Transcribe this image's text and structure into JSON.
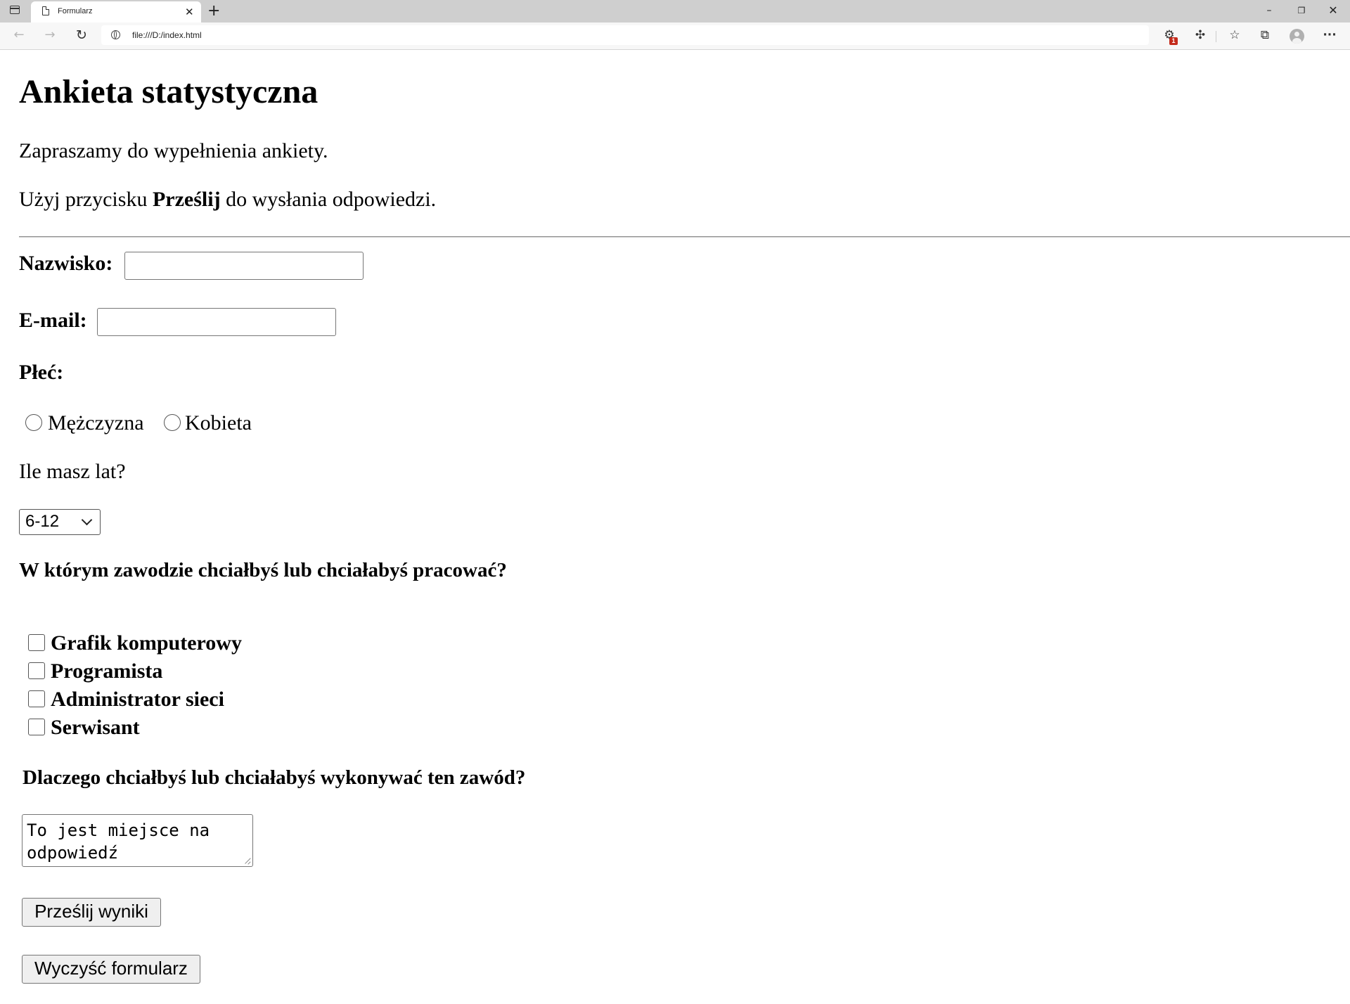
{
  "browser": {
    "tab_title": "Formularz",
    "tab_close_glyph": "✕",
    "new_tab_glyph": "+",
    "url": "file:///D:/index.html",
    "extension_badge": "1",
    "icons": [
      "tab-actions-icon",
      "page-icon",
      "back-icon",
      "forward-icon",
      "reload-icon",
      "globe-icon",
      "extension-icon",
      "puzzle-icon",
      "favorites-icon",
      "collections-icon",
      "profile-icon",
      "more-icon"
    ],
    "window": {
      "minimize": "–",
      "restore": "❐",
      "close": "✕"
    }
  },
  "page": {
    "heading": "Ankieta statystyczna",
    "intro": "Zapraszamy do wypełnienia ankiety.",
    "instruction_before": "Użyj przycisku ",
    "instruction_bold": "Prześlij",
    "instruction_after": " do wysłania odpowiedzi.",
    "surname_label": "Nazwisko:",
    "surname_value": "",
    "email_label": "E-mail:",
    "email_value": "",
    "gender_label": "Płeć:",
    "gender_options": [
      "Mężczyzna",
      "Kobieta"
    ],
    "age_question": "Ile masz lat?",
    "age_selected": "6-12",
    "job_question": "W którym zawodzie chciałbyś lub chciałabyś pracować?",
    "job_options": [
      "Grafik komputerowy",
      "Programista",
      "Administrator sieci",
      "Serwisant"
    ],
    "why_question": "Dlaczego chciałbyś lub chciałabyś wykonywać ten zawód?",
    "why_placeholder": "To jest miejsce na odpowiedź",
    "submit_label": "Prześlij wyniki",
    "reset_label": "Wyczyść formularz"
  }
}
